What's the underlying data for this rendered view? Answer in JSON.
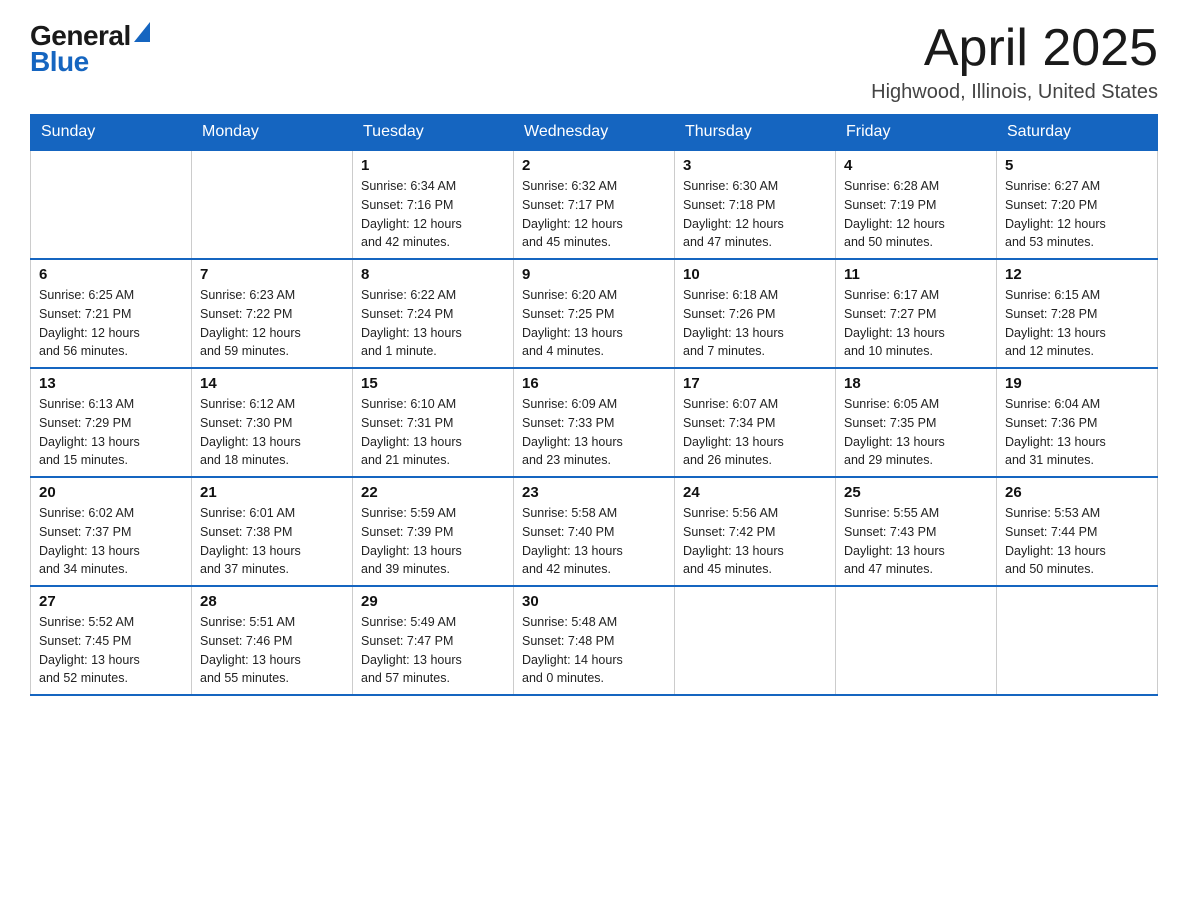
{
  "header": {
    "logo_general": "General",
    "logo_blue": "Blue",
    "month_title": "April 2025",
    "location": "Highwood, Illinois, United States"
  },
  "weekdays": [
    "Sunday",
    "Monday",
    "Tuesday",
    "Wednesday",
    "Thursday",
    "Friday",
    "Saturday"
  ],
  "weeks": [
    [
      {
        "day": "",
        "info": ""
      },
      {
        "day": "",
        "info": ""
      },
      {
        "day": "1",
        "info": "Sunrise: 6:34 AM\nSunset: 7:16 PM\nDaylight: 12 hours\nand 42 minutes."
      },
      {
        "day": "2",
        "info": "Sunrise: 6:32 AM\nSunset: 7:17 PM\nDaylight: 12 hours\nand 45 minutes."
      },
      {
        "day": "3",
        "info": "Sunrise: 6:30 AM\nSunset: 7:18 PM\nDaylight: 12 hours\nand 47 minutes."
      },
      {
        "day": "4",
        "info": "Sunrise: 6:28 AM\nSunset: 7:19 PM\nDaylight: 12 hours\nand 50 minutes."
      },
      {
        "day": "5",
        "info": "Sunrise: 6:27 AM\nSunset: 7:20 PM\nDaylight: 12 hours\nand 53 minutes."
      }
    ],
    [
      {
        "day": "6",
        "info": "Sunrise: 6:25 AM\nSunset: 7:21 PM\nDaylight: 12 hours\nand 56 minutes."
      },
      {
        "day": "7",
        "info": "Sunrise: 6:23 AM\nSunset: 7:22 PM\nDaylight: 12 hours\nand 59 minutes."
      },
      {
        "day": "8",
        "info": "Sunrise: 6:22 AM\nSunset: 7:24 PM\nDaylight: 13 hours\nand 1 minute."
      },
      {
        "day": "9",
        "info": "Sunrise: 6:20 AM\nSunset: 7:25 PM\nDaylight: 13 hours\nand 4 minutes."
      },
      {
        "day": "10",
        "info": "Sunrise: 6:18 AM\nSunset: 7:26 PM\nDaylight: 13 hours\nand 7 minutes."
      },
      {
        "day": "11",
        "info": "Sunrise: 6:17 AM\nSunset: 7:27 PM\nDaylight: 13 hours\nand 10 minutes."
      },
      {
        "day": "12",
        "info": "Sunrise: 6:15 AM\nSunset: 7:28 PM\nDaylight: 13 hours\nand 12 minutes."
      }
    ],
    [
      {
        "day": "13",
        "info": "Sunrise: 6:13 AM\nSunset: 7:29 PM\nDaylight: 13 hours\nand 15 minutes."
      },
      {
        "day": "14",
        "info": "Sunrise: 6:12 AM\nSunset: 7:30 PM\nDaylight: 13 hours\nand 18 minutes."
      },
      {
        "day": "15",
        "info": "Sunrise: 6:10 AM\nSunset: 7:31 PM\nDaylight: 13 hours\nand 21 minutes."
      },
      {
        "day": "16",
        "info": "Sunrise: 6:09 AM\nSunset: 7:33 PM\nDaylight: 13 hours\nand 23 minutes."
      },
      {
        "day": "17",
        "info": "Sunrise: 6:07 AM\nSunset: 7:34 PM\nDaylight: 13 hours\nand 26 minutes."
      },
      {
        "day": "18",
        "info": "Sunrise: 6:05 AM\nSunset: 7:35 PM\nDaylight: 13 hours\nand 29 minutes."
      },
      {
        "day": "19",
        "info": "Sunrise: 6:04 AM\nSunset: 7:36 PM\nDaylight: 13 hours\nand 31 minutes."
      }
    ],
    [
      {
        "day": "20",
        "info": "Sunrise: 6:02 AM\nSunset: 7:37 PM\nDaylight: 13 hours\nand 34 minutes."
      },
      {
        "day": "21",
        "info": "Sunrise: 6:01 AM\nSunset: 7:38 PM\nDaylight: 13 hours\nand 37 minutes."
      },
      {
        "day": "22",
        "info": "Sunrise: 5:59 AM\nSunset: 7:39 PM\nDaylight: 13 hours\nand 39 minutes."
      },
      {
        "day": "23",
        "info": "Sunrise: 5:58 AM\nSunset: 7:40 PM\nDaylight: 13 hours\nand 42 minutes."
      },
      {
        "day": "24",
        "info": "Sunrise: 5:56 AM\nSunset: 7:42 PM\nDaylight: 13 hours\nand 45 minutes."
      },
      {
        "day": "25",
        "info": "Sunrise: 5:55 AM\nSunset: 7:43 PM\nDaylight: 13 hours\nand 47 minutes."
      },
      {
        "day": "26",
        "info": "Sunrise: 5:53 AM\nSunset: 7:44 PM\nDaylight: 13 hours\nand 50 minutes."
      }
    ],
    [
      {
        "day": "27",
        "info": "Sunrise: 5:52 AM\nSunset: 7:45 PM\nDaylight: 13 hours\nand 52 minutes."
      },
      {
        "day": "28",
        "info": "Sunrise: 5:51 AM\nSunset: 7:46 PM\nDaylight: 13 hours\nand 55 minutes."
      },
      {
        "day": "29",
        "info": "Sunrise: 5:49 AM\nSunset: 7:47 PM\nDaylight: 13 hours\nand 57 minutes."
      },
      {
        "day": "30",
        "info": "Sunrise: 5:48 AM\nSunset: 7:48 PM\nDaylight: 14 hours\nand 0 minutes."
      },
      {
        "day": "",
        "info": ""
      },
      {
        "day": "",
        "info": ""
      },
      {
        "day": "",
        "info": ""
      }
    ]
  ]
}
